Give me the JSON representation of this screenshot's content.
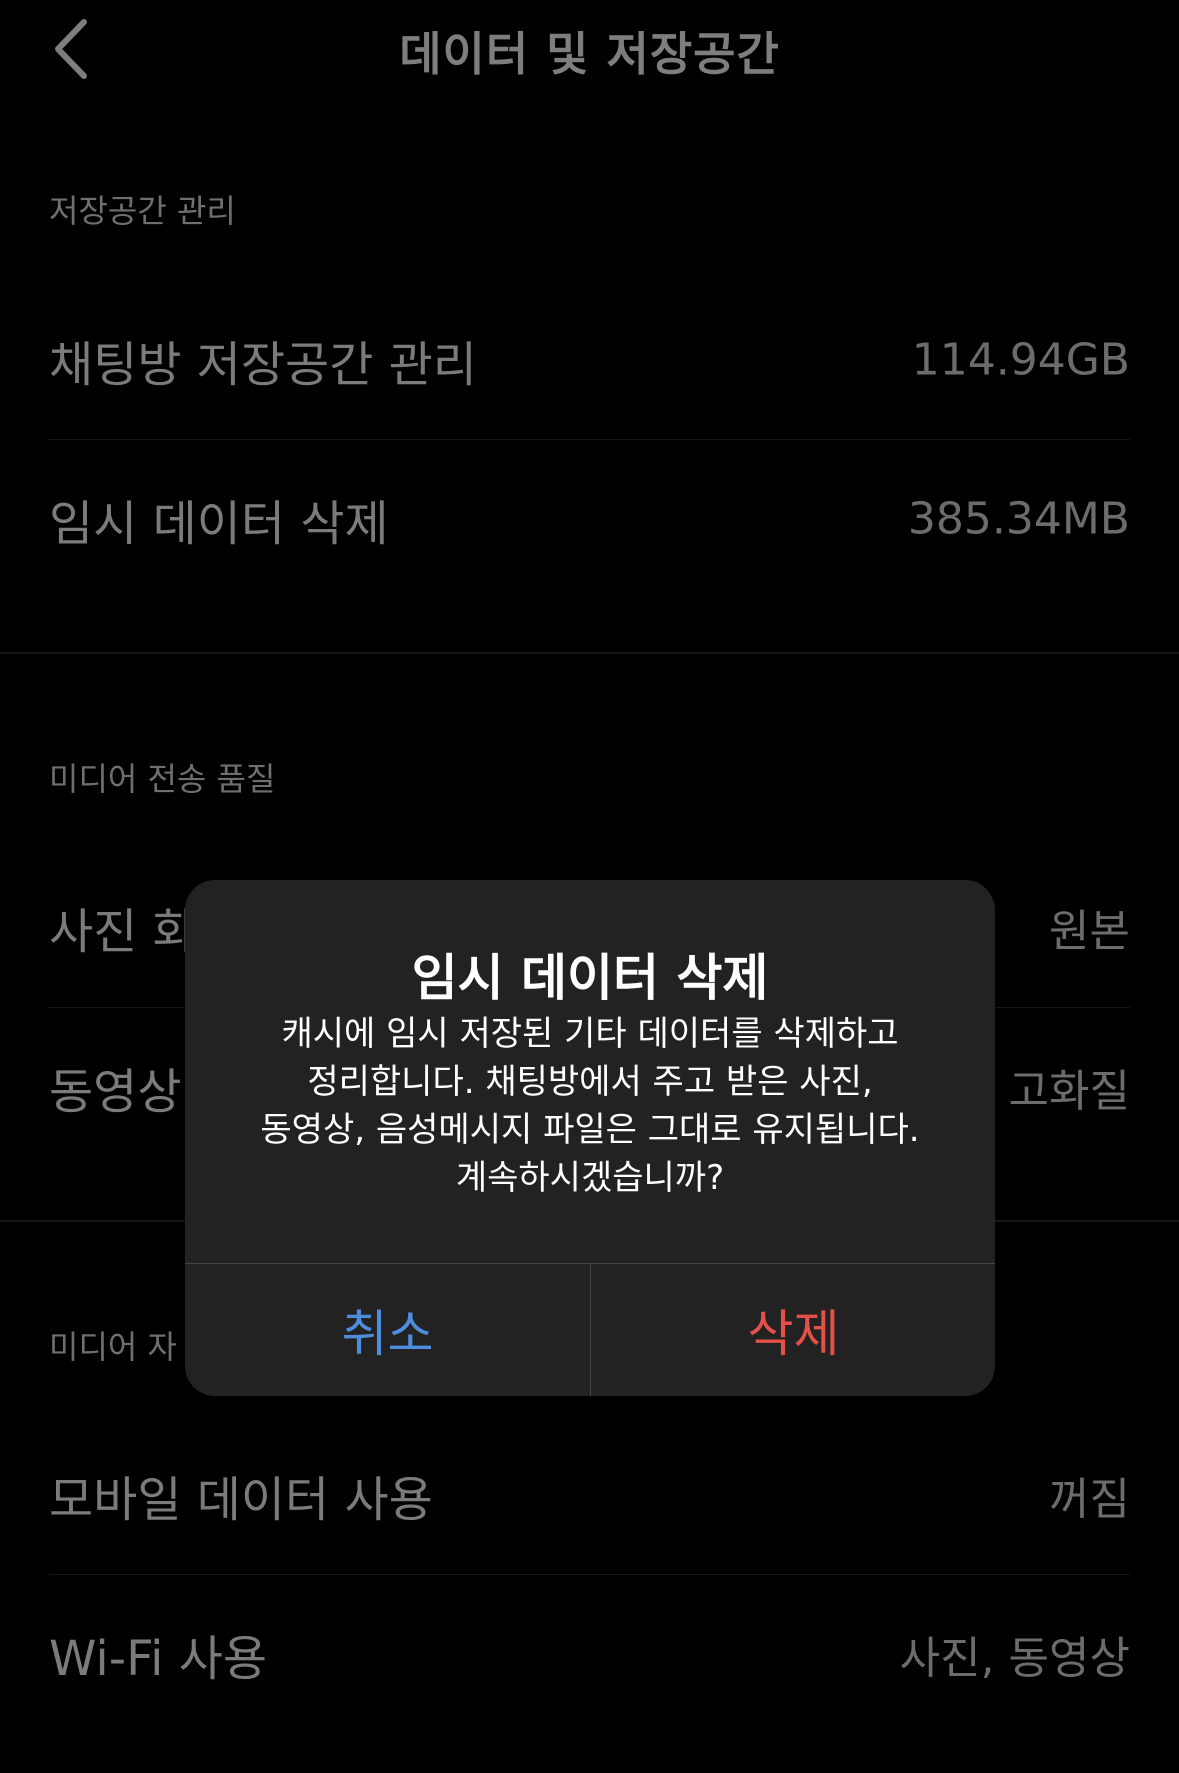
{
  "nav": {
    "title": "데이터 및 저장공간"
  },
  "sections": {
    "storage": {
      "header": "저장공간 관리",
      "rows": [
        {
          "label": "채팅방 저장공간 관리",
          "value": "114.94GB"
        },
        {
          "label": "임시 데이터 삭제",
          "value": "385.34MB"
        }
      ]
    },
    "media_quality": {
      "header": "미디어 전송 품질",
      "rows": [
        {
          "label": "사진 화",
          "value": "원본"
        },
        {
          "label": "동영상",
          "value": "고화질"
        }
      ]
    },
    "media_auto": {
      "header": "미디어 자",
      "rows": [
        {
          "label": "모바일 데이터 사용",
          "value": "꺼짐"
        },
        {
          "label": "Wi-Fi 사용",
          "value": "사진, 동영상"
        }
      ]
    }
  },
  "dialog": {
    "title": "임시 데이터 삭제",
    "message_lines": [
      "캐시에 임시 저장된 기타 데이터를 삭제하고",
      "정리합니다. 채팅방에서 주고 받은 사진,",
      "동영상, 음성메시지 파일은 그대로 유지됩니다.",
      "계속하시겠습니까?"
    ],
    "cancel_label": "취소",
    "delete_label": "삭제"
  },
  "colors": {
    "background": "#000000",
    "dialog_background": "#222222",
    "cancel_accent": "#4e8ddd",
    "destructive_accent": "#e4504a"
  },
  "icons": {
    "back": "chevron-left-icon"
  }
}
